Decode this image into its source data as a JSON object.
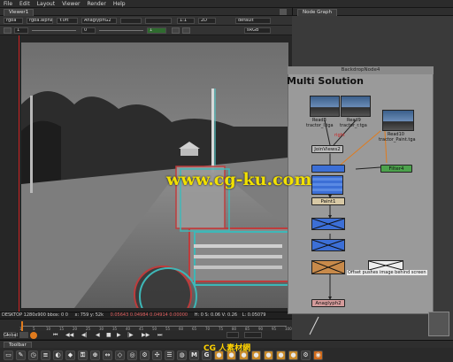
{
  "menubar": {
    "items": [
      "File",
      "Edit",
      "Layout",
      "Viewer",
      "Render",
      "Help"
    ]
  },
  "viewer": {
    "tab_label": "Viewer1",
    "toolbar1": {
      "channels": "rgba",
      "layer": "rgba.alpha",
      "colorspace": "Y.0ft",
      "input": "AnaglyphG2",
      "zoom": "1:1",
      "mode": "2D",
      "lut": "default"
    },
    "toolbar2": {
      "exposure": "1",
      "gain": "0",
      "gamma": "1",
      "input_process": "sRGB"
    },
    "status_left": "DESKTOP 1280x900 bbox: 0 0",
    "status_coords": "x: 759 y: 52k",
    "status_values": "0.05643  0.04984  0.04914  0.00000",
    "status_hsv": "H: 0 S: 0.06 V: 0.26",
    "status_l": "L: 0.05079",
    "timeline_ticks": [
      "1",
      "5",
      "10",
      "15",
      "20",
      "25",
      "30",
      "35",
      "40",
      "45",
      "50",
      "55",
      "60",
      "65",
      "70",
      "75",
      "80",
      "85",
      "90",
      "95",
      "100"
    ],
    "frame": "1",
    "global_label": "Global"
  },
  "toolbar": {
    "tab_label": "Toolbar",
    "icons": [
      "M",
      "G"
    ]
  },
  "node_graph": {
    "tab_label": "Node Graph",
    "backdrop_title": "BackdropNode4",
    "backdrop_label": "Multi Solution",
    "nodes": {
      "read8": {
        "name": "Read8",
        "file": "tractor_l.tga"
      },
      "read9": {
        "name": "Read9",
        "file": "tractor_r.tga"
      },
      "read10": {
        "name": "Read10",
        "file": "tractor_Paint.tga"
      },
      "joinviews": "JoinViews2",
      "paint": "Paint1",
      "filter": "Filter4",
      "anaglyph": "Anaglyph2",
      "offset_note": "Offset pushes image behind screen"
    },
    "labels": {
      "right": "right"
    }
  },
  "watermark": {
    "text": "www.cg-ku.com",
    "logo": "CG 人素材網"
  },
  "colors": {
    "accent_orange": "#e07b1d",
    "node_blue": "#3c6fd6",
    "node_green": "#4ca24c",
    "node_tan": "#d7c8a5",
    "node_pink": "#d49b9b"
  }
}
